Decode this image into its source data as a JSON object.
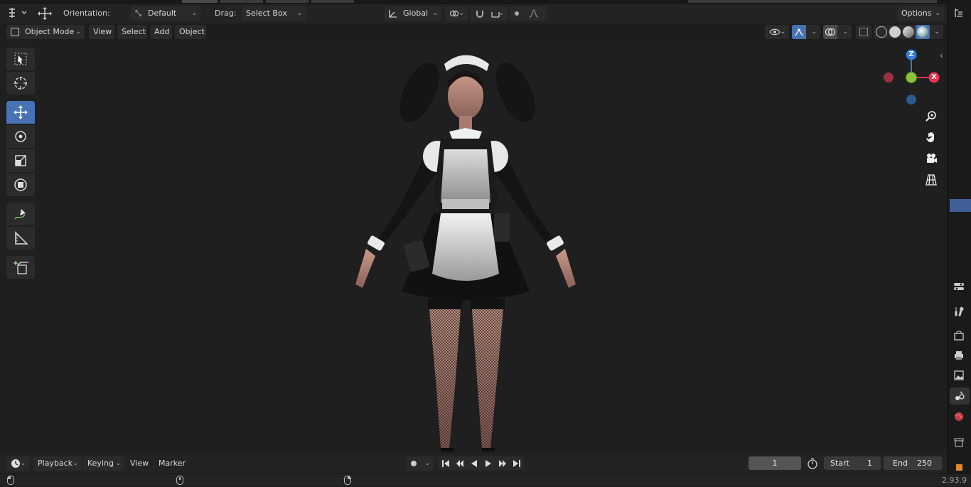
{
  "tool_header": {
    "orientation_label": "Orientation:",
    "orientation_value": "Default",
    "drag_label": "Drag:",
    "drag_value": "Select Box",
    "transform_orientation": "Global",
    "options_label": "Options"
  },
  "mode_header": {
    "mode": "Object Mode",
    "menus": [
      "View",
      "Select",
      "Add",
      "Object"
    ]
  },
  "gizmo": {
    "axis_z": "Z",
    "axis_x": "X",
    "colors": {
      "x": "#e2344f",
      "y": "#8bc33b",
      "z": "#2f7fd6",
      "neg_x": "#9b3040",
      "neg_z": "#2a5a90"
    }
  },
  "timeline": {
    "editor_menus": [
      "Playback",
      "Keying",
      "View",
      "Marker"
    ],
    "current_frame": "1",
    "start_label": "Start",
    "start_value": "1",
    "end_label": "End",
    "end_value": "250"
  },
  "status": {
    "version": "2.93.9"
  },
  "colors": {
    "accent": "#4772b3",
    "viewport_bg": "#1f1f1f",
    "header_bg": "#232323"
  }
}
